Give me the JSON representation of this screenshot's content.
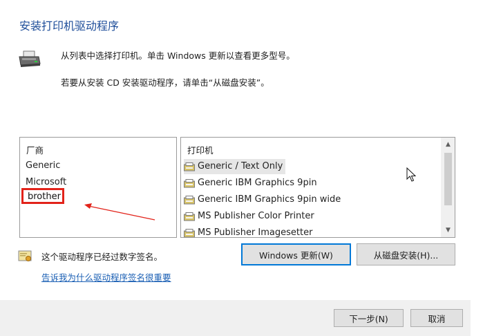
{
  "header": {
    "title": "安装打印机驱动程序",
    "line1": "从列表中选择打印机。单击 Windows 更新以查看更多型号。",
    "line2": "若要从安装 CD 安装驱动程序，请单击“从磁盘安装”。"
  },
  "manufacturers": {
    "header": "厂商",
    "items": [
      "Generic",
      "Microsoft",
      "brother"
    ],
    "selected": "brother"
  },
  "printers": {
    "header": "打印机",
    "items": [
      "Generic / Text Only",
      "Generic IBM Graphics 9pin",
      "Generic IBM Graphics 9pin wide",
      "MS Publisher Color Printer",
      "MS Publisher Imagesetter"
    ],
    "selected": "Generic / Text Only"
  },
  "signature": {
    "status": "这个驱动程序已经过数字签名。",
    "link": "告诉我为什么驱动程序签名很重要"
  },
  "buttons": {
    "windows_update": "Windows 更新(W)",
    "have_disk": "从磁盘安装(H)...",
    "next": "下一步(N)",
    "cancel": "取消"
  },
  "colors": {
    "title": "#1f4e9a",
    "link": "#1a5fb4",
    "highlight_box": "#e2231a",
    "default_button_border": "#0078d7",
    "footer": "#f0f0f0"
  },
  "icons": {
    "header": "printer-icon",
    "signature": "certificate-icon",
    "list_item": "printer-icon",
    "scroll_up": "chevron-up-icon",
    "scroll_down": "chevron-down-icon",
    "annotation": "red-arrow-icon",
    "pointer": "mouse-cursor-icon"
  }
}
